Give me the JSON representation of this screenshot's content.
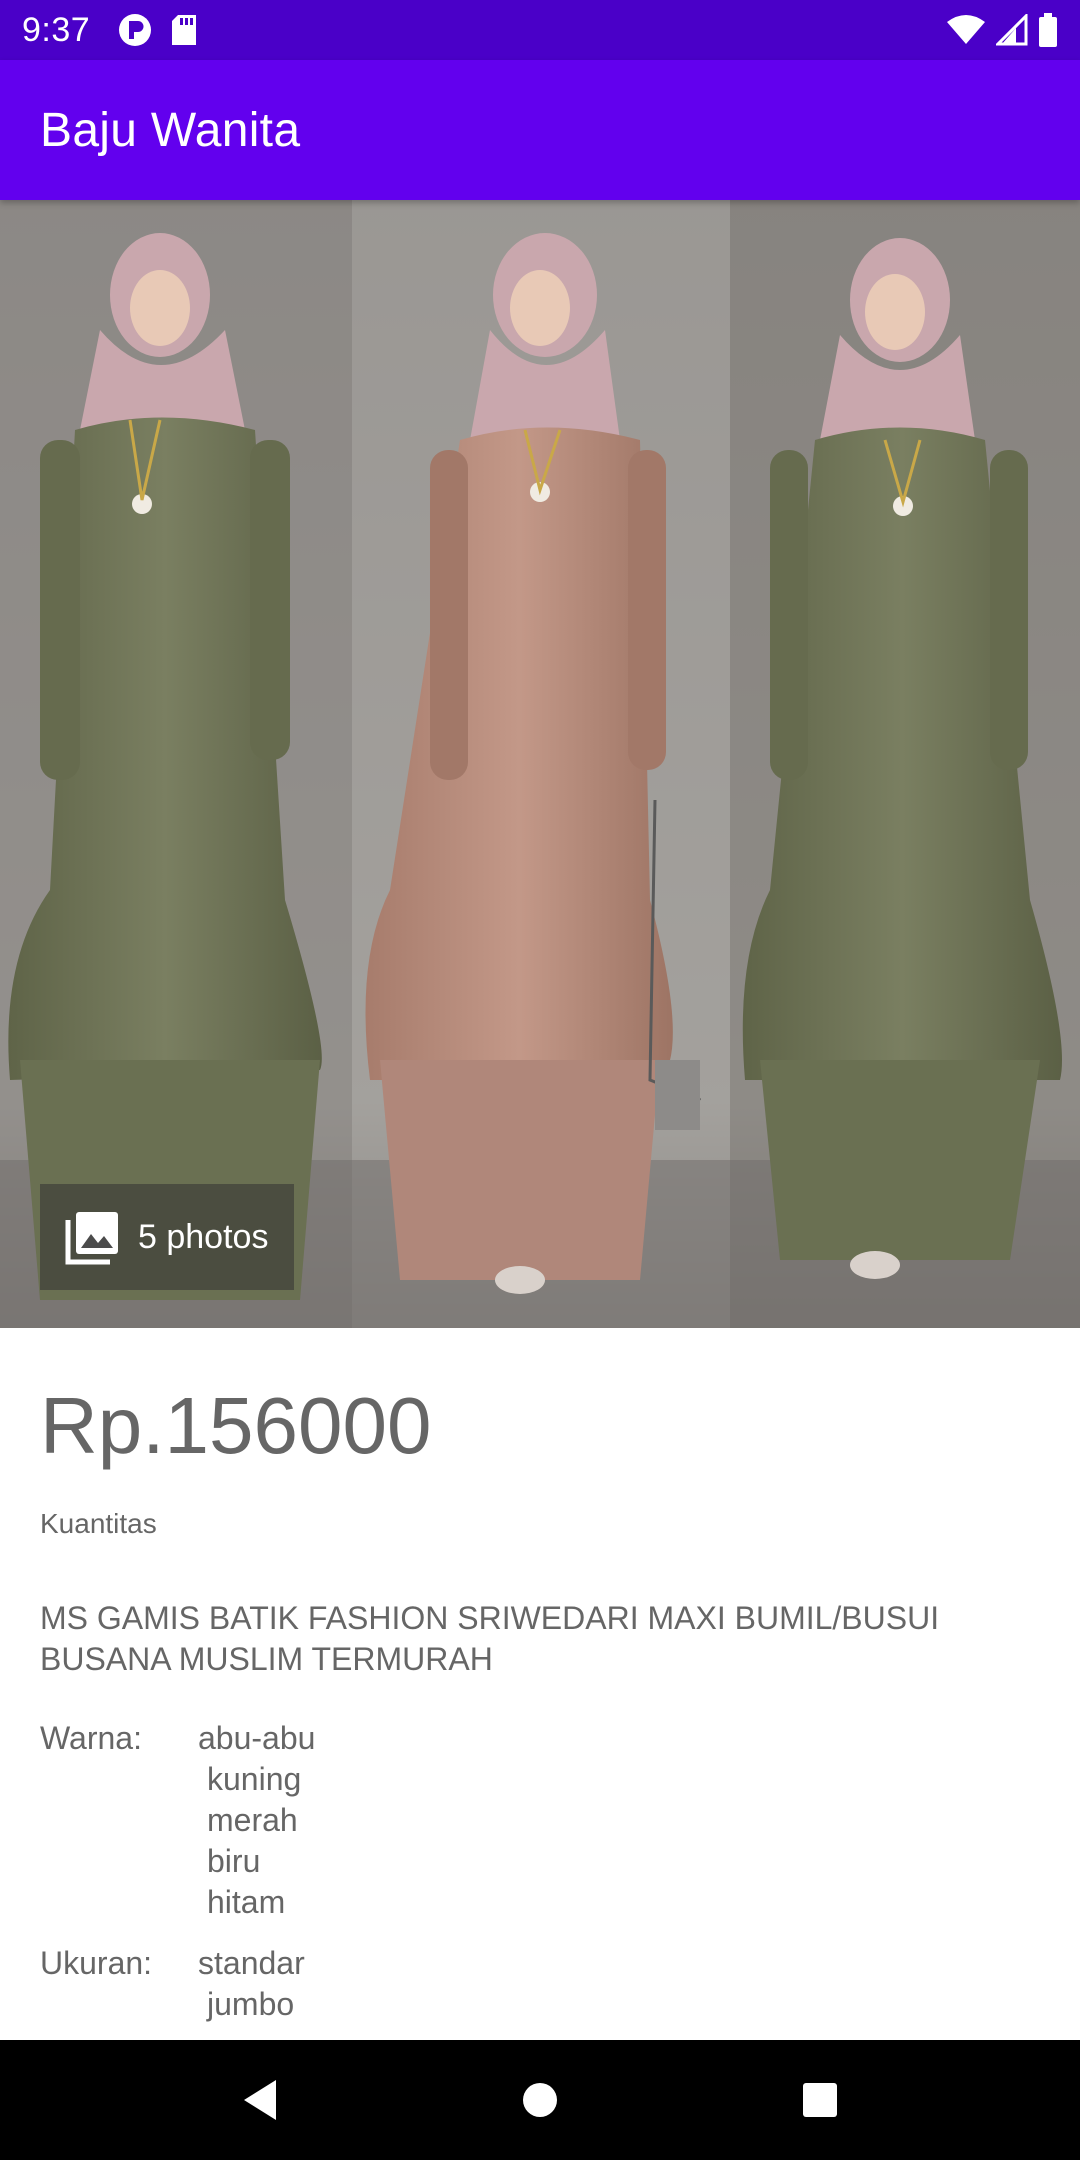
{
  "status_bar": {
    "time": "9:37",
    "left_icons": [
      "p-badge-icon",
      "sd-card-icon"
    ],
    "right_icons": [
      "wifi-icon",
      "signal-icon",
      "battery-icon"
    ]
  },
  "app_bar": {
    "title": "Baju Wanita",
    "color": "#6200ee"
  },
  "gallery": {
    "badge_icon": "photo-library-icon",
    "badge_label": "5 photos",
    "image_description_colors": [
      "#6f7458",
      "#b88d7d",
      "#6f7458"
    ]
  },
  "product": {
    "price": "Rp.156000",
    "quantity_label": "Kuantitas",
    "title": "MS GAMIS BATIK FASHION SRIWEDARI MAXI BUMIL/BUSUI BUSANA MUSLIM TERMURAH",
    "specs": {
      "color_label": "Warna:",
      "colors": [
        "abu-abu",
        "kuning",
        "merah",
        "biru",
        "hitam"
      ],
      "size_label": "Ukuran:",
      "sizes": [
        "standar",
        "jumbo"
      ]
    }
  },
  "nav_bar": {
    "buttons": [
      "back-icon",
      "home-icon",
      "recents-icon"
    ]
  }
}
